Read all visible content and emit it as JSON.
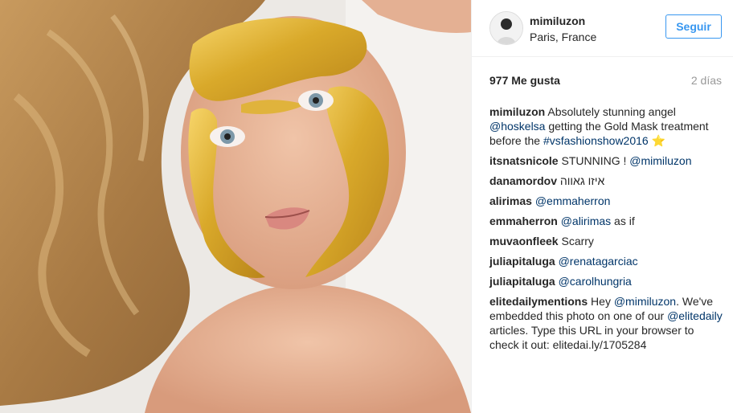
{
  "header": {
    "username": "mimiluzon",
    "location": "Paris, France",
    "follow_label": "Seguir"
  },
  "stats": {
    "likes": "977 Me gusta",
    "time": "2 días"
  },
  "caption": {
    "user": "mimiluzon",
    "text_1": "Absolutely stunning angel ",
    "mention": "@hoskelsa",
    "text_2": " getting the Gold Mask treatment before the ",
    "hashtag": "#vsfashionshow2016",
    "emoji": "⭐"
  },
  "comments": [
    {
      "user": "itsnatsnicole",
      "text": "STUNNING ! ",
      "mention": "@mimiluzon",
      "after": ""
    },
    {
      "user": "danamordov",
      "text": "איזו גאווה",
      "mention": "",
      "after": ""
    },
    {
      "user": "alirimas",
      "text": "",
      "mention": "@emmaherron",
      "after": ""
    },
    {
      "user": "emmaherron",
      "text": "",
      "mention": "@alirimas",
      "after": " as if"
    },
    {
      "user": "muvaonfleek",
      "text": "Scarry",
      "mention": "",
      "after": ""
    },
    {
      "user": "juliapitaluga",
      "text": "",
      "mention": "@renatagarciac",
      "after": ""
    },
    {
      "user": "juliapitaluga",
      "text": "",
      "mention": "@carolhungria",
      "after": ""
    }
  ],
  "last_comment": {
    "user": "elitedailymentions",
    "text_1": " Hey ",
    "mention_1": "@mimiluzon",
    "text_2": ". We've embedded this photo on one of our ",
    "mention_2": "@elitedaily",
    "text_3": " articles. Type this URL in your browser to check it out: elitedai.ly/1705284"
  },
  "colors": {
    "accent": "#3897f0",
    "link": "#003569",
    "text": "#262626",
    "muted": "#999999",
    "gold": "#d9a92a"
  },
  "icons": {
    "star": "star-emoji-icon"
  }
}
